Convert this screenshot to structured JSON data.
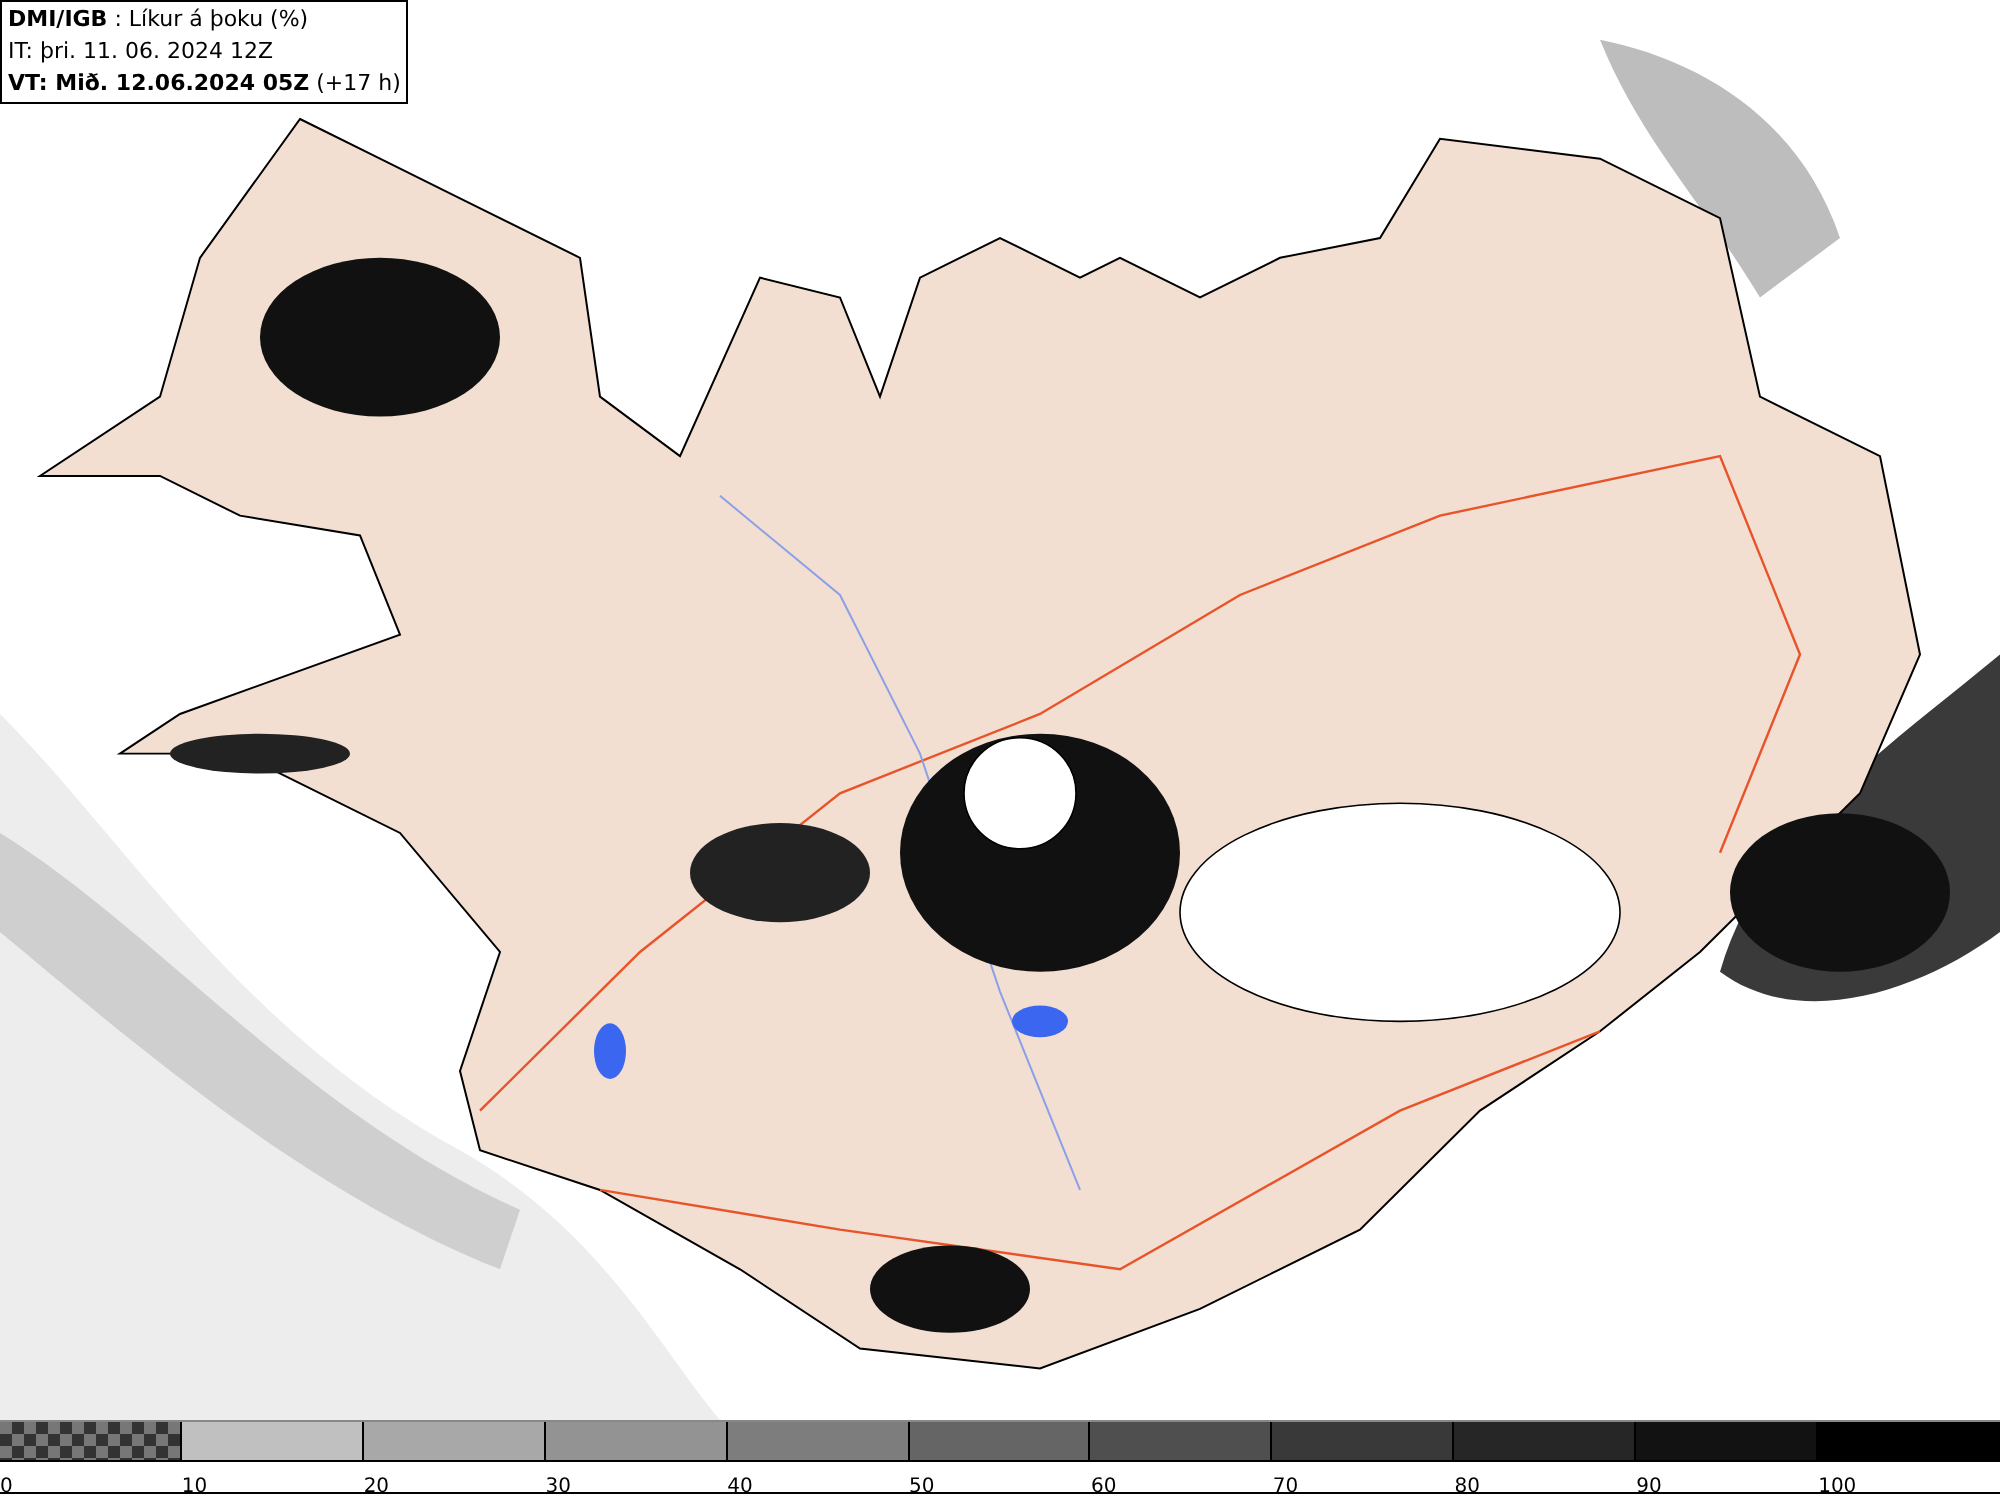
{
  "header": {
    "lines": [
      "**DMI/IGB** : Líkur á þoku (%)",
      "IT: þri. 11. 06. 2024 12Z",
      "**VT: Mið. 12.06.2024 05Z** (+17 h)"
    ]
  },
  "legend": {
    "swatches": [
      {
        "kind": "checker"
      },
      {
        "kind": "solid",
        "color": "#c0c0c0"
      },
      {
        "kind": "solid",
        "color": "#a8a8a8"
      },
      {
        "kind": "solid",
        "color": "#939393"
      },
      {
        "kind": "solid",
        "color": "#7d7d7d"
      },
      {
        "kind": "solid",
        "color": "#656565"
      },
      {
        "kind": "solid",
        "color": "#4f4f4f"
      },
      {
        "kind": "solid",
        "color": "#393939"
      },
      {
        "kind": "solid",
        "color": "#262626"
      },
      {
        "kind": "solid",
        "color": "#121212"
      },
      {
        "kind": "solid",
        "color": "#000000"
      }
    ],
    "ticks": [
      "0",
      "10",
      "20",
      "30",
      "40",
      "50",
      "60",
      "70",
      "80",
      "90",
      "100"
    ]
  }
}
